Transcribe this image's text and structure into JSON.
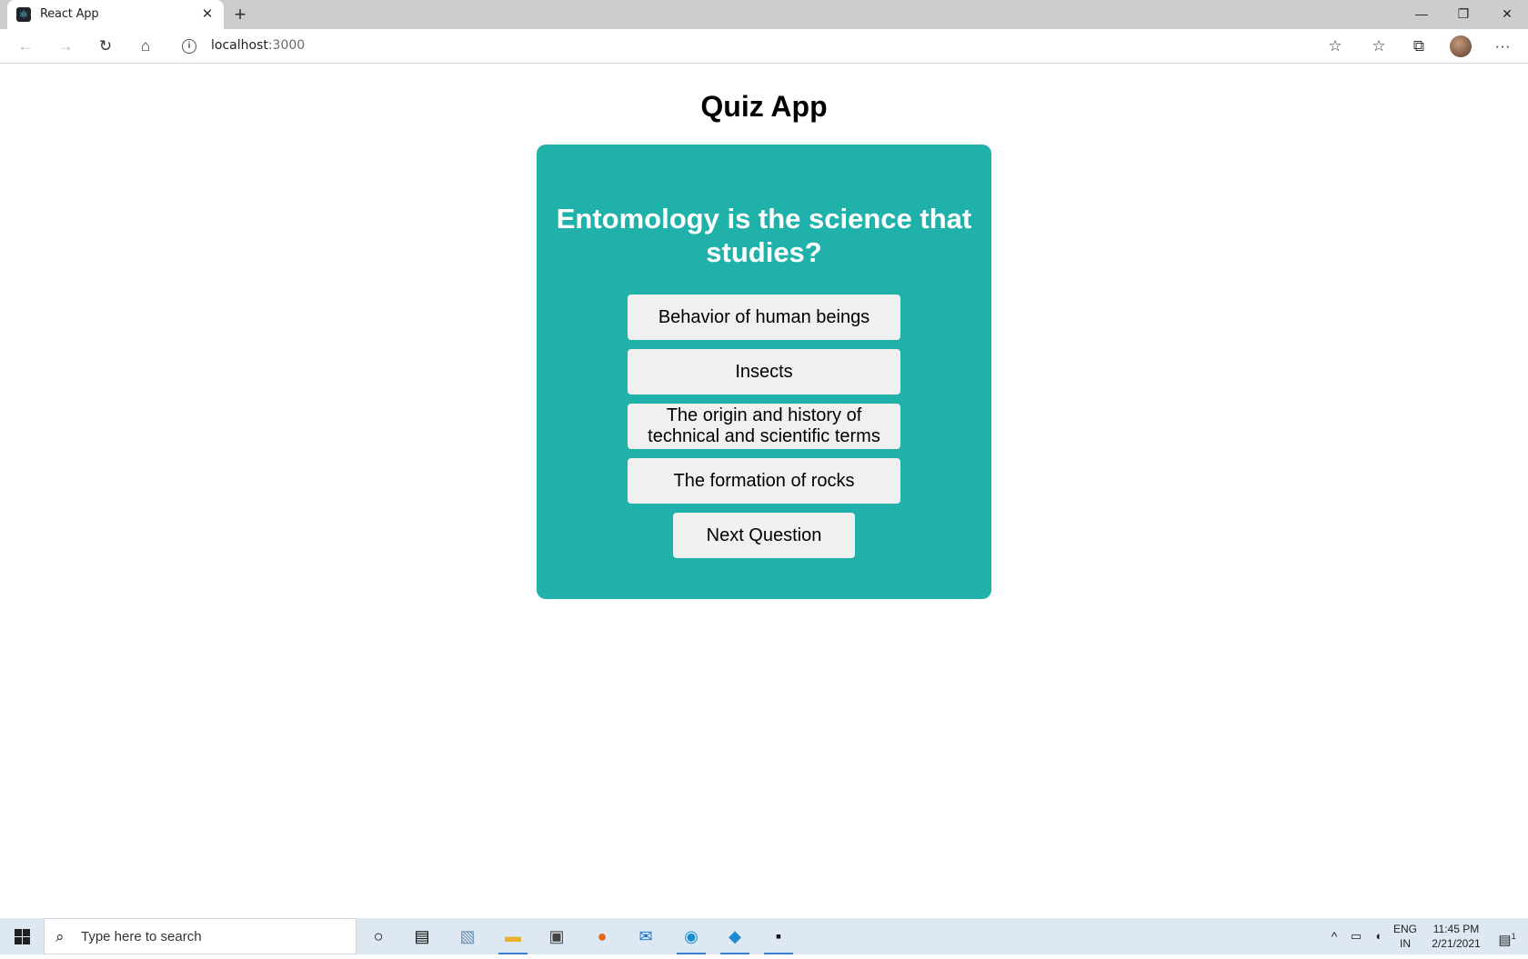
{
  "browser": {
    "tab_title": "React App",
    "tab_close": "✕",
    "new_tab": "+",
    "window_minimize": "—",
    "window_restore": "❐",
    "window_close": "✕",
    "address_host": "localhost",
    "address_port": ":3000",
    "more": "···"
  },
  "page": {
    "title": "Quiz App"
  },
  "quiz": {
    "question": "Entomology is the science that studies?",
    "answers": [
      "Behavior of human beings",
      "Insects",
      "The origin and history of technical and scientific terms",
      "The formation of rocks"
    ],
    "next_label": "Next Question",
    "card_color": "#20b2aa"
  },
  "taskbar": {
    "search_placeholder": "Type here to search",
    "language_line1": "ENG",
    "language_line2": "IN",
    "time": "11:45 PM",
    "date": "2/21/2021",
    "notifications": "1"
  }
}
